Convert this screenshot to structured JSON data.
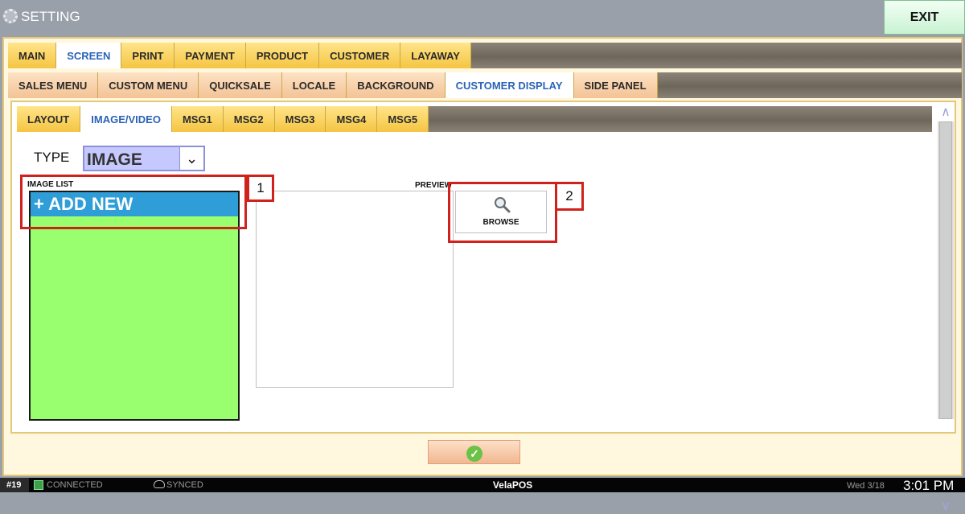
{
  "window": {
    "title": "SETTING",
    "exit_label": "EXIT"
  },
  "tabs_main": [
    "MAIN",
    "SCREEN",
    "PRINT",
    "PAYMENT",
    "PRODUCT",
    "CUSTOMER",
    "LAYAWAY"
  ],
  "tabs_screen": [
    "SALES MENU",
    "CUSTOM MENU",
    "QUICKSALE",
    "LOCALE",
    "BACKGROUND",
    "CUSTOMER DISPLAY",
    "SIDE PANEL"
  ],
  "tabs_display": [
    "LAYOUT",
    "IMAGE/VIDEO",
    "MSG1",
    "MSG2",
    "MSG3",
    "MSG4",
    "MSG5"
  ],
  "active": {
    "main": "SCREEN",
    "screen": "CUSTOMER DISPLAY",
    "display": "IMAGE/VIDEO"
  },
  "form": {
    "type_label": "TYPE",
    "type_value": "IMAGE",
    "image_list_label": "IMAGE LIST",
    "add_new_label": "+ ADD NEW",
    "preview_label": "PREVIEW",
    "browse_label": "BROWSE"
  },
  "annotations": {
    "marker_1": "1",
    "marker_2": "2"
  },
  "status": {
    "terminal": "#19",
    "connection": "CONNECTED",
    "sync": "SYNCED",
    "brand": "VelaPOS",
    "date": "Wed 3/18",
    "time": "3:01 PM"
  },
  "colors": {
    "image_list_bg": "#99ff6e",
    "add_new_bg": "#2f9ed8",
    "active_tab_text": "#2a63b7",
    "annotation_red": "#d0221c",
    "type_select_bg": "#c5c9ff"
  },
  "icons": {
    "title": "gear-icon",
    "browse": "magnifier-icon",
    "confirm": "checkmark-icon",
    "connection": "network-icon",
    "sync": "cloud-icon"
  }
}
